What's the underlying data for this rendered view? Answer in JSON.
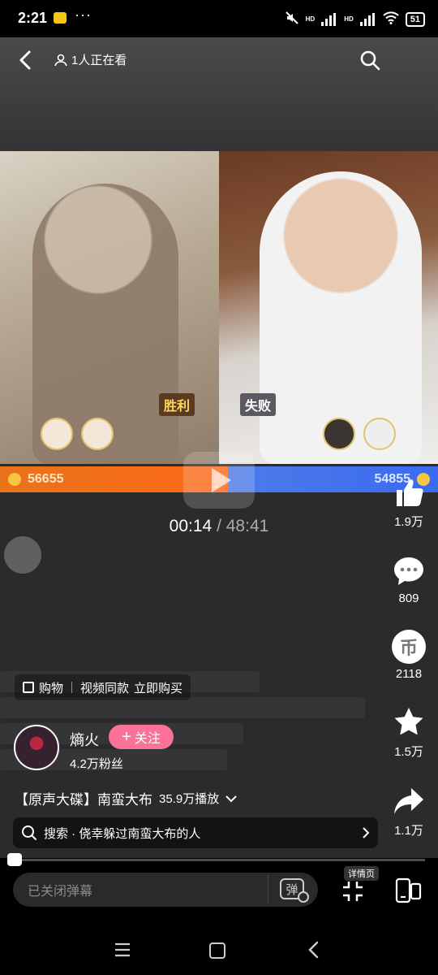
{
  "status_bar": {
    "time": "2:21",
    "dots": "···",
    "battery": "51",
    "net_label_1": "HD",
    "net_label_2": "HD"
  },
  "header": {
    "watching": "1人正在看"
  },
  "stream": {
    "tag_win": "胜利",
    "tag_lose": "失败",
    "score_left": "56655",
    "score_right": "54855",
    "score_left_fraction": 0.52
  },
  "player": {
    "current_time": "00:14",
    "total_time": "/ 48:41",
    "progress_fraction": 0.005
  },
  "actions": {
    "like_count": "1.9万",
    "comment_count": "809",
    "coin_count": "2118",
    "coin_glyph": "币",
    "favorite_count": "1.5万",
    "share_count": "1.1万"
  },
  "shop": {
    "item1": "购物",
    "item2": "视频同款",
    "item3": "立即购买"
  },
  "creator": {
    "name": "熵火",
    "follow_label": "关注",
    "fans": "4.2万粉丝"
  },
  "video": {
    "title": "【原声大碟】南蛮大布",
    "plays": "35.9万播放"
  },
  "search": {
    "text": "搜索 · 侥幸躲过南蛮大布的人"
  },
  "bottom_bar": {
    "danmaku_placeholder": "已关闭弹幕",
    "danmaku_toggle": "弹",
    "detail_tag": "详情页"
  },
  "icons": {
    "back": "back-arrow-icon",
    "watching": "viewers-icon",
    "search": "search-icon",
    "like": "thumbs-up-icon",
    "comment": "comment-icon",
    "coin": "coin-icon",
    "favorite": "star-icon",
    "share": "share-icon",
    "fullscreen": "exit-fullscreen-icon",
    "portrait": "portrait-mode-icon"
  },
  "colors": {
    "accent_pink": "#fb7299",
    "pk_orange": "#ff6a1a",
    "pk_blue": "#3a6af0"
  }
}
